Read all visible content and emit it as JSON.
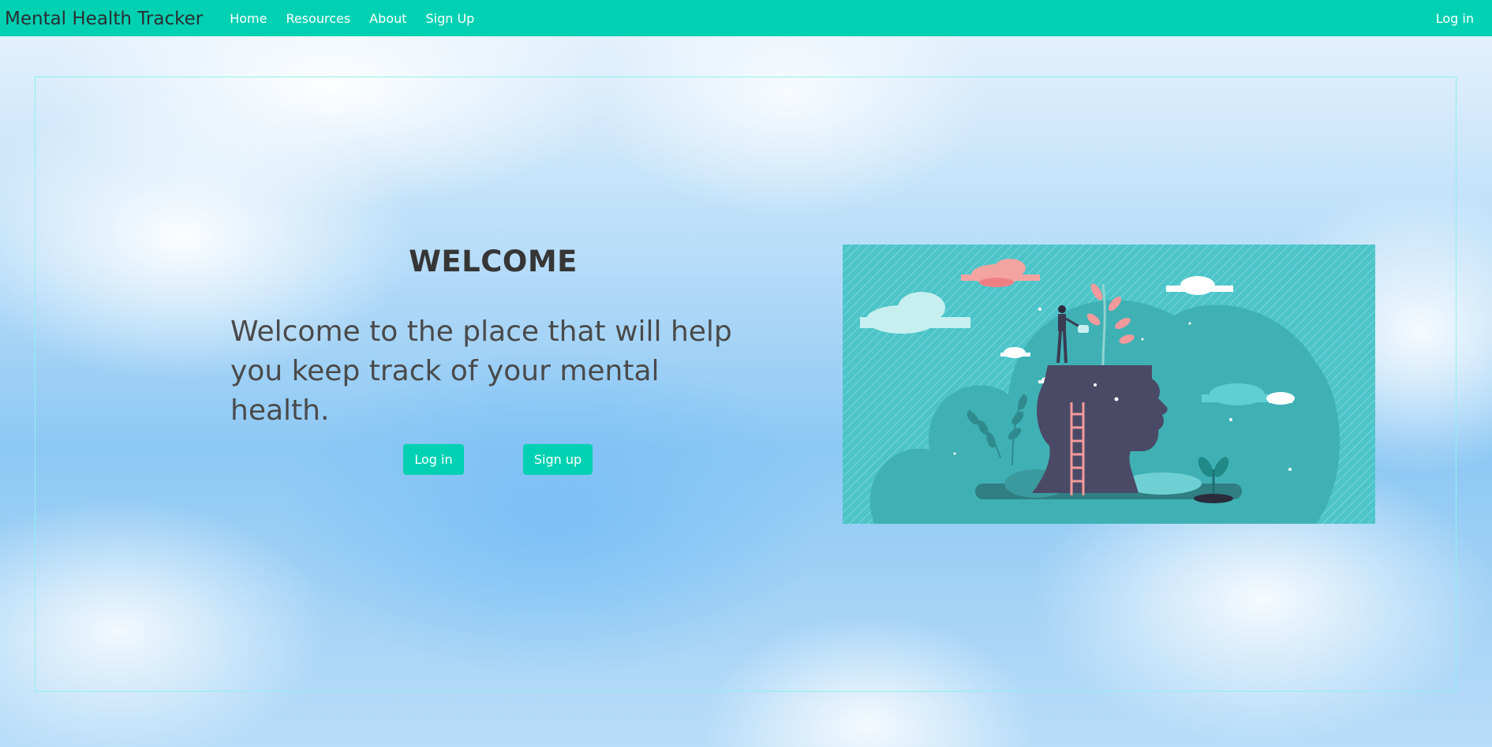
{
  "navbar": {
    "brand": "Mental Health Tracker",
    "links": [
      {
        "label": "Home"
      },
      {
        "label": "Resources"
      },
      {
        "label": "About"
      },
      {
        "label": "Sign Up"
      }
    ],
    "login_label": "Log in"
  },
  "hero": {
    "title": "WELCOME",
    "subtitle": "Welcome to the place that will help you keep track of your mental health.",
    "login_button": "Log in",
    "signup_button": "Sign up"
  },
  "illustration": {
    "subject": "head-with-plant-illustration"
  },
  "colors": {
    "accent": "#00d1b2",
    "frame_border": "#8ff1ef",
    "illustration_bg": "#4cc4c8",
    "head": "#4a4a66"
  }
}
